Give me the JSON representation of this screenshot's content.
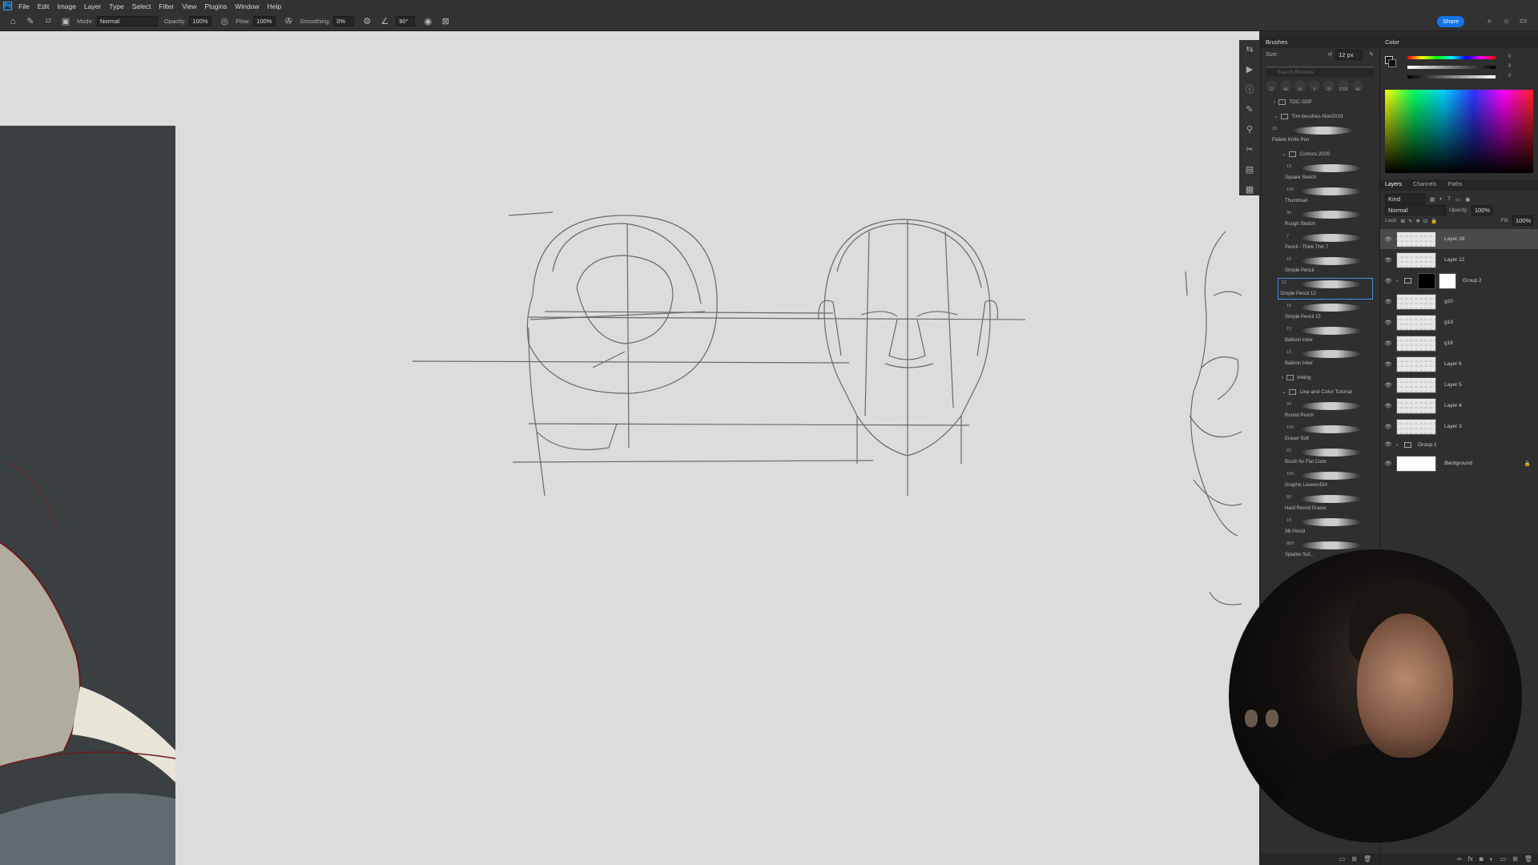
{
  "menu": {
    "logo": "Ps",
    "items": [
      "File",
      "Edit",
      "Image",
      "Layer",
      "Type",
      "Select",
      "Filter",
      "View",
      "Plugins",
      "Window",
      "Help"
    ]
  },
  "options": {
    "mode_label": "Mode:",
    "mode_value": "Normal",
    "opacity_label": "Opacity:",
    "opacity_value": "100%",
    "flow_label": "Flow:",
    "flow_value": "100%",
    "smoothing_label": "Smoothing:",
    "smoothing_value": "0%",
    "angle_value": "90°",
    "share_label": "Share",
    "brush_size": "12"
  },
  "brushes": {
    "tab": "Brushes",
    "size_label": "Size:",
    "size_value": "12 px",
    "search_placeholder": "Search Brushes",
    "preset_sizes": [
      "12",
      "40",
      "91",
      "9",
      "20",
      "1700",
      "40"
    ],
    "folders": {
      "f1": "TDC-SSP",
      "f2": "Tim-brushes-Nov2019",
      "f3": "Comics 2020",
      "f4": "Inking",
      "f5": "Line and Color Tutorial"
    },
    "items": [
      {
        "num": "15",
        "name": "Pallete Knife Pen"
      },
      {
        "num": "13",
        "name": "Square Sketch"
      },
      {
        "num": "100",
        "name": "Thumbnail"
      },
      {
        "num": "30",
        "name": "Rough Sketch"
      },
      {
        "num": "7",
        "name": "Pencil - Think Thin 7"
      },
      {
        "num": "15",
        "name": "Simple Pencil"
      },
      {
        "num": "12",
        "name": "Simple Pencil 12"
      },
      {
        "num": "15",
        "name": "Simple Pencil 15"
      },
      {
        "num": "15",
        "name": "Balloon Inker"
      },
      {
        "num": "15",
        "name": "Balloon Inker"
      },
      {
        "num": "60",
        "name": "Round Pencil"
      },
      {
        "num": "150",
        "name": "Eraser Soft"
      },
      {
        "num": "83",
        "name": "Brush for Flat Color"
      },
      {
        "num": "150",
        "name": "Graphic Leaves/Dirt"
      },
      {
        "num": "60",
        "name": "Hard Round Eraser"
      },
      {
        "num": "15",
        "name": "3B Pencil"
      },
      {
        "num": "800",
        "name": "Splatter Sof..."
      }
    ]
  },
  "color": {
    "tab": "Color",
    "value_1": "0",
    "value_2": "0",
    "value_3": "0"
  },
  "layers": {
    "tabs": [
      "Layers",
      "Channels",
      "Paths"
    ],
    "kind_label": "Kind",
    "blend_mode": "Normal",
    "opacity_label": "Opacity:",
    "opacity_value": "100%",
    "lock_label": "Lock:",
    "fill_label": "Fill:",
    "fill_value": "100%",
    "rows": [
      {
        "name": "Layer 28"
      },
      {
        "name": "Layer 12"
      },
      {
        "name": "Group 2"
      },
      {
        "name": "g20"
      },
      {
        "name": "g19"
      },
      {
        "name": "g18"
      },
      {
        "name": "Layer 6"
      },
      {
        "name": "Layer 5"
      },
      {
        "name": "Layer 4"
      },
      {
        "name": "Layer 3"
      },
      {
        "name": "Group 1"
      },
      {
        "name": "Background"
      }
    ]
  },
  "colors": {
    "accent": "#1473e6",
    "panel": "#2f2f2f",
    "canvas": "#dcdcdc"
  }
}
